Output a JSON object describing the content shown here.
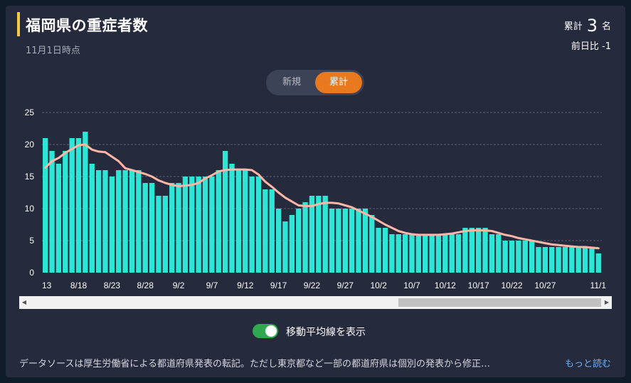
{
  "header": {
    "title": "福岡県の重症者数",
    "date": "11月1日時点",
    "total_prefix": "累計",
    "total_value": "3",
    "total_unit": "名",
    "diff": "前日比 -1"
  },
  "toggle": {
    "new_label": "新規",
    "cumulative_label": "累計",
    "selected": "累計"
  },
  "moving_average": {
    "label": "移動平均線を表示",
    "enabled": true
  },
  "footer": {
    "source_text": "データソースは厚生労働省による都道府県発表の転記。ただし東京都など一部の都道府県は個別の発表から修正…",
    "more_link": "もっと読む"
  },
  "colors": {
    "bar": "#2ee6d6",
    "avg_line": "#ffb6a6",
    "accent": "#e8791f",
    "title_bar": "#f2c94c"
  },
  "chart_data": {
    "type": "bar",
    "x_tick_labels": [
      "13",
      "8/18",
      "8/23",
      "8/28",
      "9/2",
      "9/7",
      "9/12",
      "9/17",
      "9/22",
      "9/27",
      "10/2",
      "10/7",
      "10/12",
      "10/17",
      "10/22",
      "10/27",
      "11/1"
    ],
    "y_ticks": [
      0,
      5,
      10,
      15,
      20,
      25
    ],
    "ylim": [
      0,
      25
    ],
    "grid": true,
    "values": [
      21,
      19,
      17,
      19,
      21,
      21,
      22,
      17,
      16,
      16,
      15,
      16,
      16,
      16,
      16,
      14,
      14,
      12,
      12,
      14,
      14,
      15,
      15,
      15,
      15,
      15,
      16,
      19,
      17,
      16,
      16,
      15,
      15,
      13,
      13,
      10,
      8,
      9,
      10,
      11,
      12,
      12,
      12,
      10,
      10,
      10,
      10,
      10,
      10,
      9,
      7,
      7,
      6,
      6,
      6,
      6,
      6,
      6,
      6,
      6,
      6,
      6,
      6,
      7,
      7,
      7,
      7,
      6,
      6,
      5,
      5,
      5,
      5,
      5,
      4,
      4,
      4,
      4,
      4,
      4,
      4,
      4,
      4,
      3
    ],
    "moving_average": [
      16.4,
      17.4,
      17.9,
      18.7,
      19.3,
      19.9,
      20.0,
      19.2,
      18.9,
      18.8,
      18.1,
      17.4,
      16.3,
      16.0,
      15.7,
      15.4,
      15.0,
      14.4,
      14.0,
      13.7,
      13.5,
      13.6,
      13.7,
      14.0,
      14.7,
      15.2,
      15.8,
      16.0,
      16.1,
      16.1,
      16.1,
      16.0,
      15.3,
      14.2,
      13.4,
      12.5,
      11.7,
      11.1,
      10.5,
      10.4,
      10.4,
      10.7,
      10.9,
      10.9,
      10.8,
      10.5,
      10.2,
      9.7,
      9.2,
      8.7,
      8.1,
      7.5,
      7.0,
      6.5,
      6.2,
      6.0,
      5.9,
      5.9,
      5.9,
      5.9,
      6.0,
      6.1,
      6.3,
      6.5,
      6.6,
      6.6,
      6.6,
      6.5,
      6.2,
      5.9,
      5.7,
      5.4,
      5.2,
      5.0,
      4.8,
      4.6,
      4.4,
      4.3,
      4.2,
      4.1,
      4.0,
      4.0,
      3.9,
      3.8
    ]
  }
}
